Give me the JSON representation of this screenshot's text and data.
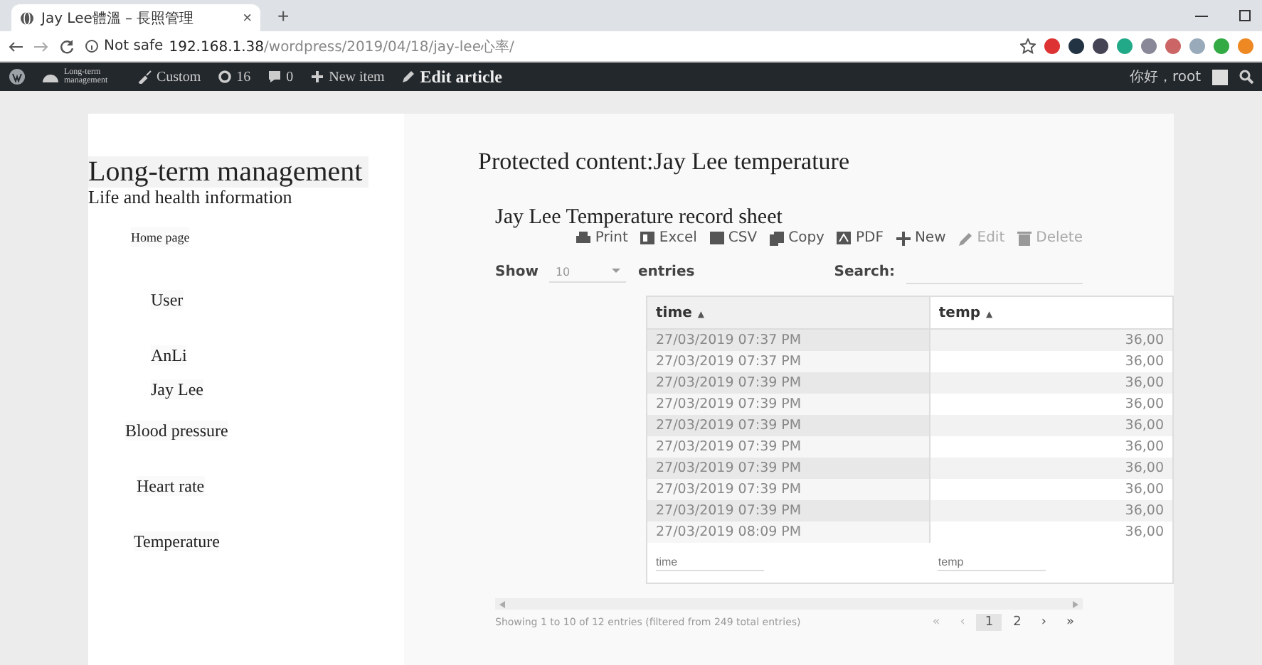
{
  "browser": {
    "tab_title": "Jay Lee體溫 – 長照管理",
    "tab_close": "×",
    "new_tab": "+",
    "security": "Not safe",
    "host": "192.168.1.38",
    "path": "/wordpress/2019/04/18/jay-lee心率/"
  },
  "admin_bar": {
    "site": "Long-term management",
    "items": [
      {
        "kind": "customize",
        "label": "Custom"
      },
      {
        "kind": "updates",
        "label": "16"
      },
      {
        "kind": "comments",
        "label": "0"
      },
      {
        "kind": "new",
        "label": "New item"
      },
      {
        "kind": "edit",
        "label": "Edit article"
      }
    ],
    "greeting": "你好，root"
  },
  "sidebar": {
    "title": "Long-term management",
    "subtitle": "Life and health information",
    "items": [
      {
        "kind": "home",
        "label": "Home page"
      },
      {
        "kind": "section",
        "label": "User"
      },
      {
        "kind": "sub",
        "label": "AnLi"
      },
      {
        "kind": "sub",
        "label": "Jay Lee"
      },
      {
        "kind": "section",
        "label": "Blood pressure"
      },
      {
        "kind": "section",
        "label": "Heart rate"
      },
      {
        "kind": "section",
        "label": "Temperature"
      }
    ]
  },
  "main": {
    "title": "Protected content:Jay Lee temperature",
    "sheet_title": "Jay Lee Temperature record sheet",
    "toolbar": [
      {
        "kind": "print",
        "label": "Print",
        "disabled": false
      },
      {
        "kind": "excel",
        "label": "Excel",
        "disabled": false
      },
      {
        "kind": "csv",
        "label": "CSV",
        "disabled": false
      },
      {
        "kind": "copy",
        "label": "Copy",
        "disabled": false
      },
      {
        "kind": "pdf",
        "label": "PDF",
        "disabled": false
      },
      {
        "kind": "new",
        "label": "New",
        "disabled": false
      },
      {
        "kind": "edit",
        "label": "Edit",
        "disabled": true
      },
      {
        "kind": "delete",
        "label": "Delete",
        "disabled": true
      }
    ],
    "length": {
      "prefix": "Show",
      "value": "10",
      "suffix": "entries"
    },
    "search_label": "Search:",
    "table": {
      "columns": [
        {
          "label": "time",
          "sorted": true,
          "arrow": "▲"
        },
        {
          "label": "temp",
          "sorted": false,
          "arrow": "▲"
        }
      ],
      "rows": [
        [
          "27/03/2019 07:37 PM",
          "36,00"
        ],
        [
          "27/03/2019 07:37 PM",
          "36,00"
        ],
        [
          "27/03/2019 07:39 PM",
          "36,00"
        ],
        [
          "27/03/2019 07:39 PM",
          "36,00"
        ],
        [
          "27/03/2019 07:39 PM",
          "36,00"
        ],
        [
          "27/03/2019 07:39 PM",
          "36,00"
        ],
        [
          "27/03/2019 07:39 PM",
          "36,00"
        ],
        [
          "27/03/2019 07:39 PM",
          "36,00"
        ],
        [
          "27/03/2019 07:39 PM",
          "36,00"
        ],
        [
          "27/03/2019 08:09 PM",
          "36,00"
        ]
      ],
      "filters": [
        {
          "placeholder": "time"
        },
        {
          "placeholder": "temp"
        }
      ]
    },
    "info": "Showing 1 to 10 of 12 entries (filtered from 249 total entries)",
    "pagination": [
      {
        "label": "«",
        "disabled": true,
        "selected": false
      },
      {
        "label": "‹",
        "disabled": true,
        "selected": false
      },
      {
        "label": "1",
        "disabled": false,
        "selected": true
      },
      {
        "label": "2",
        "disabled": false,
        "selected": false
      },
      {
        "label": "›",
        "disabled": false,
        "selected": false
      },
      {
        "label": "»",
        "disabled": false,
        "selected": false
      }
    ]
  }
}
